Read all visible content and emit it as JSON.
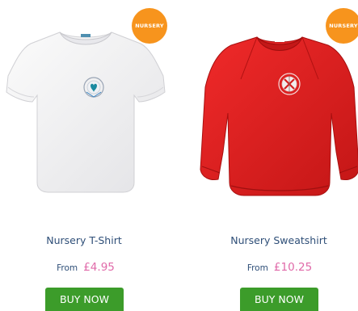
{
  "products": [
    {
      "badge": "NURSERY",
      "name": "Nursery T-Shirt",
      "price_prefix": "From",
      "price": "£4.95",
      "button_label": "BUY NOW",
      "image_icon": "white-tshirt-icon",
      "garment_color": "#f4f4f4"
    },
    {
      "badge": "NURSERY",
      "name": "Nursery Sweatshirt",
      "price_prefix": "From",
      "price": "£10.25",
      "button_label": "BUY NOW",
      "image_icon": "red-sweatshirt-icon",
      "garment_color": "#e02020"
    }
  ],
  "colors": {
    "badge_bg": "#f7941d",
    "name_text": "#2f4f78",
    "price_text": "#e06aa9",
    "button_bg": "#3c9c2a"
  }
}
